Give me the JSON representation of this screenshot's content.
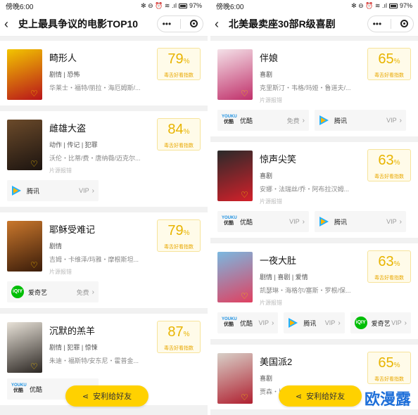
{
  "left": {
    "status": {
      "time": "傍晚6:00",
      "icons": "✻ ⊖ ⏰ ≋ .ıl",
      "battery": "97%"
    },
    "nav": {
      "title": "史上最具争议的电影TOP10",
      "more": "•••"
    },
    "cards": [
      {
        "title": "畸形人",
        "genre": "剧情 | 恐怖",
        "cast": "华莱士・福特/丽拉・海厄姆斯/...",
        "source": "",
        "score": "79",
        "pct": "%",
        "score_label": "毒舌好看指数",
        "poster_colors": [
          "#f2c500",
          "#b8141a"
        ],
        "platforms": []
      },
      {
        "title": "雌雄大盗",
        "genre": "动作 | 传记 | 犯罪",
        "cast": "沃伦・比蒂/费・唐纳薇/迈克尔...",
        "source": "片源报错",
        "score": "84",
        "pct": "%",
        "score_label": "毒舌好看指数",
        "poster_colors": [
          "#6b4a2a",
          "#1c1410"
        ],
        "platforms": [
          {
            "logo": "tencent",
            "name": "腾讯",
            "price": "VIP"
          }
        ]
      },
      {
        "title": "耶稣受难记",
        "genre": "剧情",
        "cast": "吉姆・卡维泽/玛雅・摩根斯坦...",
        "source": "片源报错",
        "score": "79",
        "pct": "%",
        "score_label": "毒舌好看指数",
        "poster_colors": [
          "#c9772c",
          "#3a1c0a"
        ],
        "platforms": [
          {
            "logo": "iqiyi",
            "name": "爱奇艺",
            "price": "免费"
          }
        ]
      },
      {
        "title": "沉默的羔羊",
        "genre": "剧情 | 犯罪 | 惊悚",
        "cast": "朱迪・福斯特/安东尼・霍普金...",
        "source": "",
        "score": "87",
        "pct": "%",
        "score_label": "毒舌好看指数",
        "poster_colors": [
          "#e8e2d8",
          "#2b2622"
        ],
        "platforms": [
          {
            "logo": "youku",
            "name": "优酷",
            "price": ""
          }
        ]
      }
    ],
    "share": "安利给好友"
  },
  "right": {
    "status": {
      "time": "傍晚6:00",
      "icons": "✻ ⊖ ⏰ ≋ .ıl",
      "battery": "97%"
    },
    "nav": {
      "title": "北美最卖座30部R级喜剧",
      "more": "•••"
    },
    "cards": [
      {
        "title": "伴娘",
        "genre": "喜剧",
        "cast": "克里斯汀・韦格/玛娅・鲁道夫/...",
        "source": "片源报错",
        "score": "65",
        "pct": "%",
        "score_label": "毒舌好看指数",
        "poster_colors": [
          "#f4e1e8",
          "#c0306a"
        ],
        "platforms": [
          {
            "logo": "youku",
            "name": "优酷",
            "price": "免费"
          },
          {
            "logo": "tencent",
            "name": "腾讯",
            "price": "VIP"
          }
        ]
      },
      {
        "title": "惊声尖笑",
        "genre": "喜剧",
        "cast": "安娜・法瑞丝/乔・阿布拉汉姆...",
        "source": "片源报错",
        "score": "63",
        "pct": "%",
        "score_label": "毒舌好看指数",
        "poster_colors": [
          "#2a2a2a",
          "#d4202a"
        ],
        "platforms": [
          {
            "logo": "youku",
            "name": "优酷",
            "price": "VIP"
          },
          {
            "logo": "tencent",
            "name": "腾讯",
            "price": "VIP"
          }
        ]
      },
      {
        "title": "一夜大肚",
        "genre": "剧情 | 喜剧 | 爱情",
        "cast": "凯瑟琳・海格尔/塞斯・罗根/保...",
        "source": "片源报错",
        "score": "63",
        "pct": "%",
        "score_label": "毒舌好看指数",
        "poster_colors": [
          "#7ab8e0",
          "#e04060"
        ],
        "platforms": [
          {
            "logo": "youku",
            "name": "优酷",
            "price": "VIP"
          },
          {
            "logo": "tencent",
            "name": "腾讯",
            "price": "VIP"
          },
          {
            "logo": "iqiyi",
            "name": "爱奇艺",
            "price": "VIP"
          }
        ]
      },
      {
        "title": "美国派2",
        "genre": "喜剧",
        "cast": "贾森・比格斯/克里斯・克莱恩/...",
        "source": "",
        "score": "65",
        "pct": "%",
        "score_label": "毒舌好看指数",
        "poster_colors": [
          "#d8d0c8",
          "#b02030"
        ],
        "platforms": []
      }
    ],
    "share": "安利给好友"
  },
  "watermark": "欧漫露"
}
